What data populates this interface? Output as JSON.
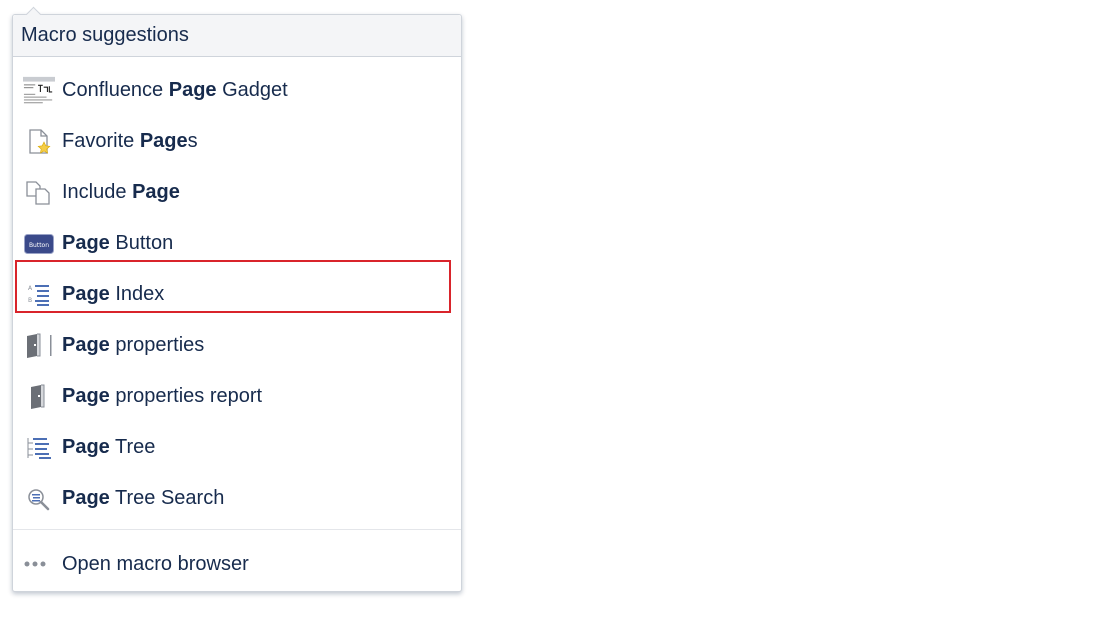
{
  "dropdown": {
    "header": "Macro suggestions",
    "items": [
      {
        "pre": "Confluence ",
        "bold": "Page",
        "post": " Gadget",
        "icon": "gadget-icon"
      },
      {
        "pre": "Favorite ",
        "bold": "Page",
        "post": "s",
        "icon": "favorite-pages-icon"
      },
      {
        "pre": "Include ",
        "bold": "Page",
        "post": "",
        "icon": "include-page-icon"
      },
      {
        "pre": "",
        "bold": "Page",
        "post": " Button",
        "icon": "page-button-icon",
        "icon_text": "Button"
      },
      {
        "pre": "",
        "bold": "Page",
        "post": " Index",
        "icon": "page-index-icon"
      },
      {
        "pre": "",
        "bold": "Page",
        "post": " properties",
        "icon": "page-properties-icon"
      },
      {
        "pre": "",
        "bold": "Page",
        "post": " properties report",
        "icon": "page-properties-report-icon"
      },
      {
        "pre": "",
        "bold": "Page",
        "post": " Tree",
        "icon": "page-tree-icon"
      },
      {
        "pre": "",
        "bold": "Page",
        "post": " Tree Search",
        "icon": "page-tree-search-icon"
      }
    ],
    "footer": {
      "label": "Open macro browser",
      "icon": "ellipsis-icon"
    }
  },
  "colors": {
    "highlight": "#d9242b",
    "text": "#172b4d",
    "button_icon_bg": "#3b4a8a"
  }
}
